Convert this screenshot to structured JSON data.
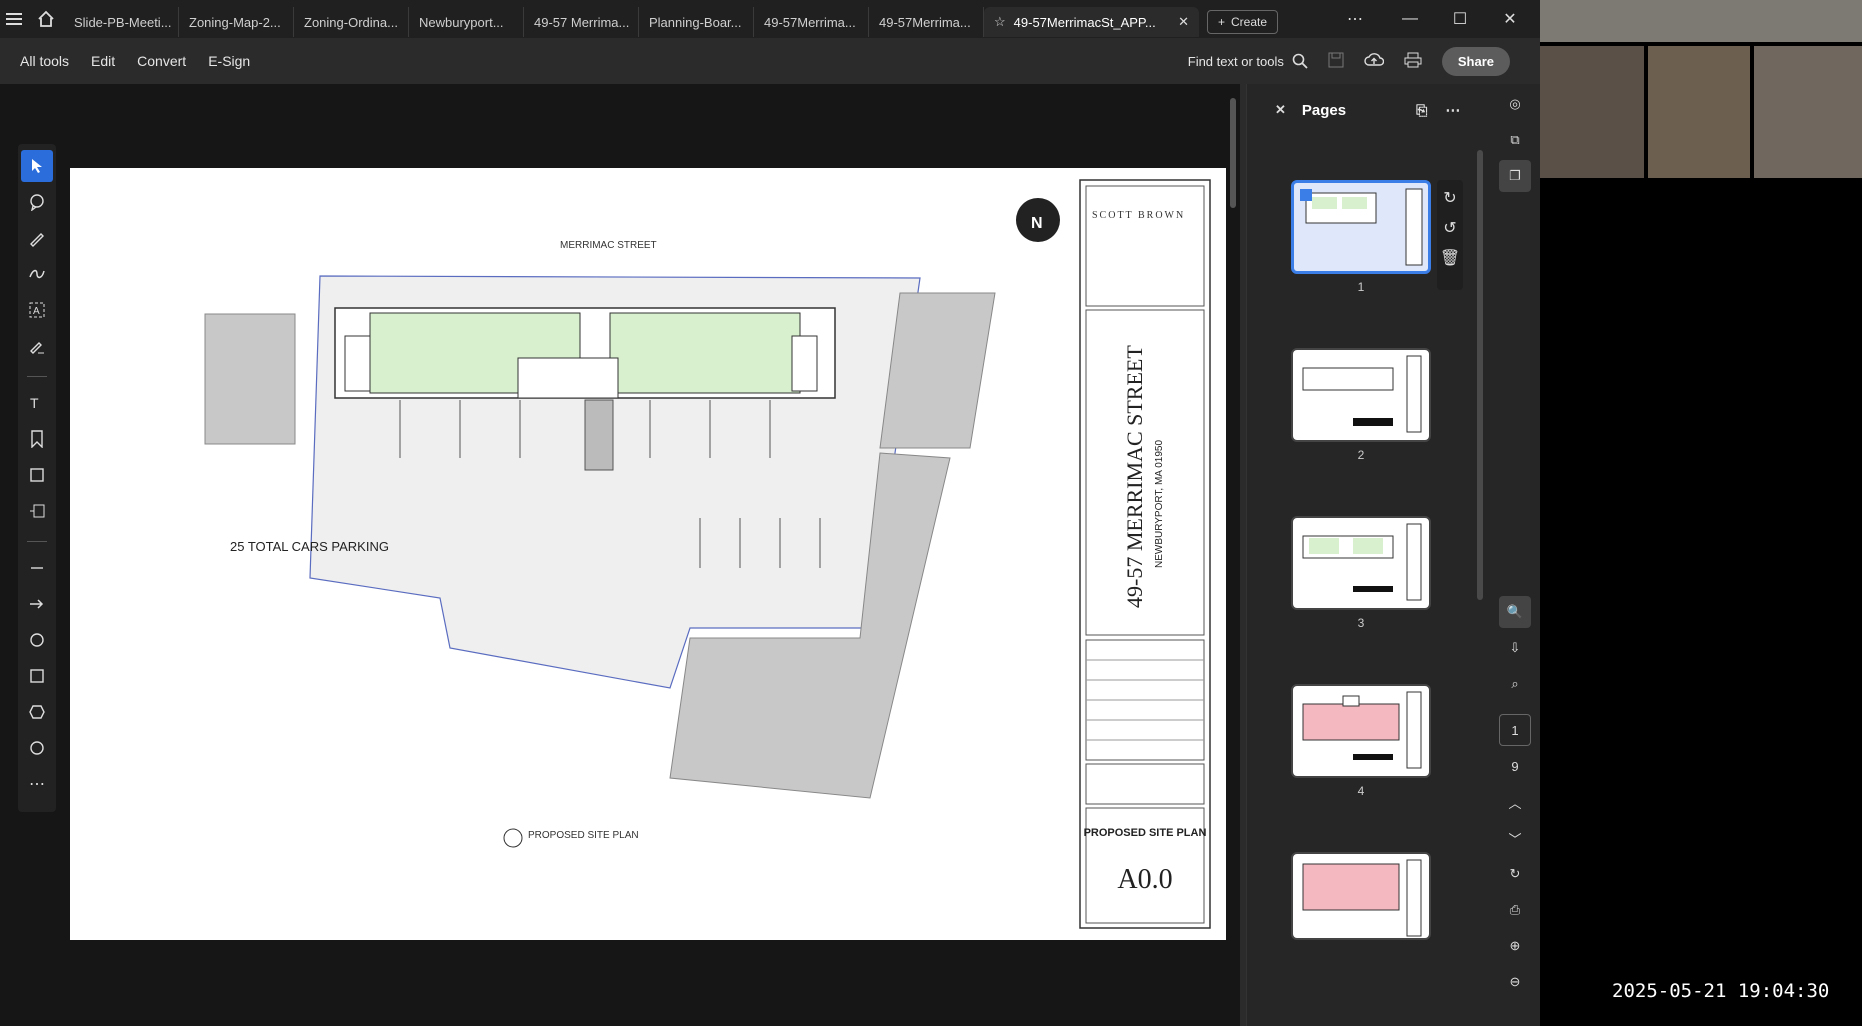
{
  "tabs": [
    {
      "label": "Slide-PB-Meeti..."
    },
    {
      "label": "Zoning-Map-2..."
    },
    {
      "label": "Zoning-Ordina..."
    },
    {
      "label": "Newburyport..."
    },
    {
      "label": "49-57 Merrima..."
    },
    {
      "label": "Planning-Boar..."
    },
    {
      "label": "49-57Merrima..."
    },
    {
      "label": "49-57Merrima..."
    }
  ],
  "active_tab": {
    "label": "49-57MerrimacSt_APP..."
  },
  "create_label": "Create",
  "toolbar": {
    "all_tools": "All tools",
    "edit": "Edit",
    "convert": "Convert",
    "esign": "E-Sign",
    "find": "Find text or tools",
    "share": "Share"
  },
  "pages_pane": {
    "title": "Pages",
    "thumbnails": [
      {
        "num": "1"
      },
      {
        "num": "2"
      },
      {
        "num": "3"
      },
      {
        "num": "4"
      }
    ]
  },
  "page_nav": {
    "current": "1",
    "total": "9"
  },
  "document": {
    "street_label": "MERRIMAC STREET",
    "parking_label": "25 TOTAL CARS PARKING",
    "plan_caption": "PROPOSED SITE PLAN",
    "firm": "SCOTT BROWN",
    "project_title": "49-57 MERRIMAC STREET",
    "project_city": "NEWBURYPORT, MA 01950",
    "sheet_title": "PROPOSED SITE PLAN",
    "sheet_number": "A0.0",
    "north": "N"
  },
  "timestamp": "2025-05-21  19:04:30",
  "colors": {
    "accent": "#2a6ddb",
    "selected_thumb": "#3b7ee8",
    "green_fill": "#d9f0cf",
    "gray_fill": "#c8c8c8",
    "pink_fill": "#f4b8c0"
  }
}
